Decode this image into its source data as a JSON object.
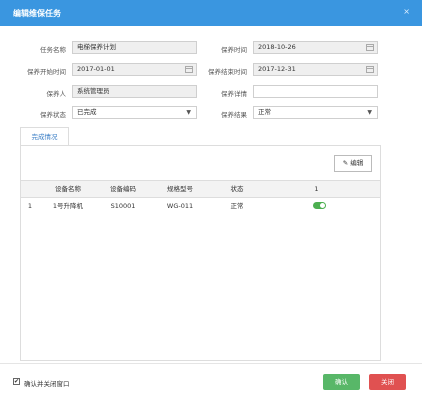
{
  "dialog": {
    "title": "编辑维保任务",
    "close_icon": "×"
  },
  "form": {
    "task_name": {
      "label": "任务名称",
      "value": "电梯保养计划"
    },
    "maintain_time": {
      "label": "保养时间",
      "value": "2018-10-26"
    },
    "start_time": {
      "label": "保养开始时间",
      "value": "2017-01-01"
    },
    "end_time": {
      "label": "保养结束时间",
      "value": "2017-12-31"
    },
    "maintainer": {
      "label": "保养人",
      "value": "系统管理员"
    },
    "detail": {
      "label": "保养详情",
      "value": ""
    },
    "status": {
      "label": "保养状态",
      "value": "已完成"
    },
    "result": {
      "label": "保养结果",
      "value": "正常"
    }
  },
  "tabs": [
    {
      "label": "完成情况"
    }
  ],
  "panel": {
    "edit_label": "编辑",
    "edit_icon": "✎"
  },
  "grid": {
    "headers": [
      "",
      "设备名称",
      "设备编码",
      "规格型号",
      "状态",
      "1"
    ],
    "rows": [
      {
        "index": "1",
        "name": "1号升降机",
        "code": "S10001",
        "model": "WG-011",
        "status": "正常",
        "toggle_on": true
      }
    ]
  },
  "footer": {
    "checkbox_label": "确认并关闭窗口",
    "checkbox_checked": true,
    "checkbox_mark": "✔",
    "confirm_label": "确认",
    "cancel_label": "关闭",
    "colors": {
      "titlebar": "#3a96e0",
      "confirm": "#58b768",
      "cancel": "#e05151",
      "toggle": "#4caf50"
    }
  }
}
